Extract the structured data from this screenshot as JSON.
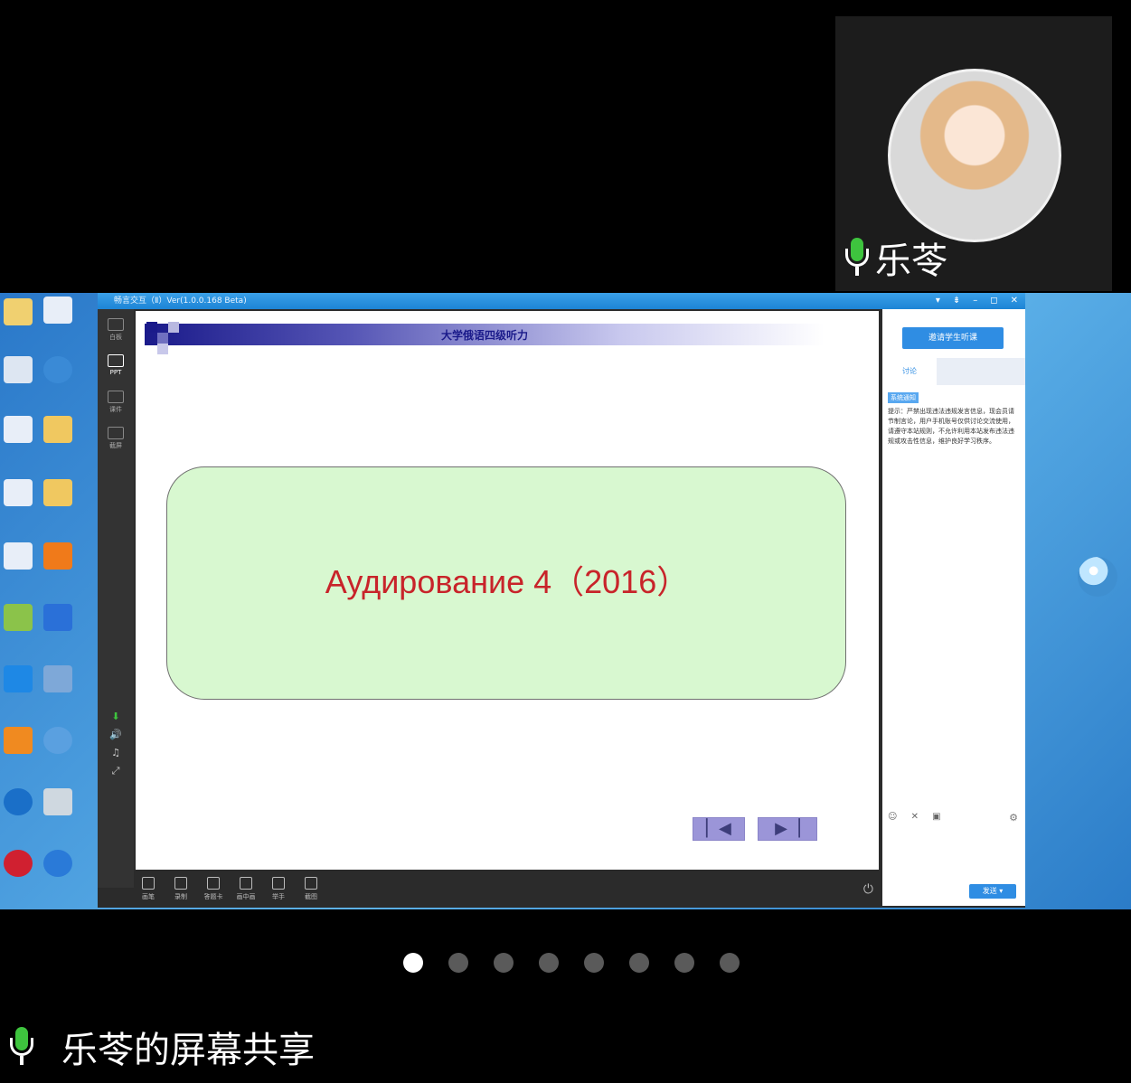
{
  "participant": {
    "name": "乐苓",
    "mic_color": "#3ec43e"
  },
  "shared_window": {
    "title": "畅言交互（Ⅱ）Ver(1.0.0.168 Beta)",
    "window_controls": [
      "▾",
      "⇟",
      "–",
      "◻",
      "✕"
    ],
    "left_tools": [
      "白板",
      "PPT",
      "课件",
      "截屏"
    ],
    "slide": {
      "header_title": "大学俄语四级听力",
      "main_text": "Аудирование 4（2016）",
      "prev_glyph": "▏◀",
      "next_glyph": "▶▕"
    },
    "bottom_tools": [
      "画笔",
      "录制",
      "答题卡",
      "画中画",
      "举手",
      "截图"
    ],
    "right_panel": {
      "button_label": "邀请学生听课",
      "tab_label": "讨论",
      "badge": "系统通知",
      "notice": "提示：严禁出现违法违规发言信息，现会员请节制言论，用户手机账号仅供讨论交流使用，请遵守本站规则，不允许利用本站发布违法违规或攻击性信息，维护良好学习秩序。",
      "tools": "☺ ✕ ▣",
      "gear": "⚙",
      "send_label": "发送 ▾"
    }
  },
  "pagination": {
    "count": 8,
    "active_index": 0
  },
  "share_label": "乐苓的屏幕共享"
}
